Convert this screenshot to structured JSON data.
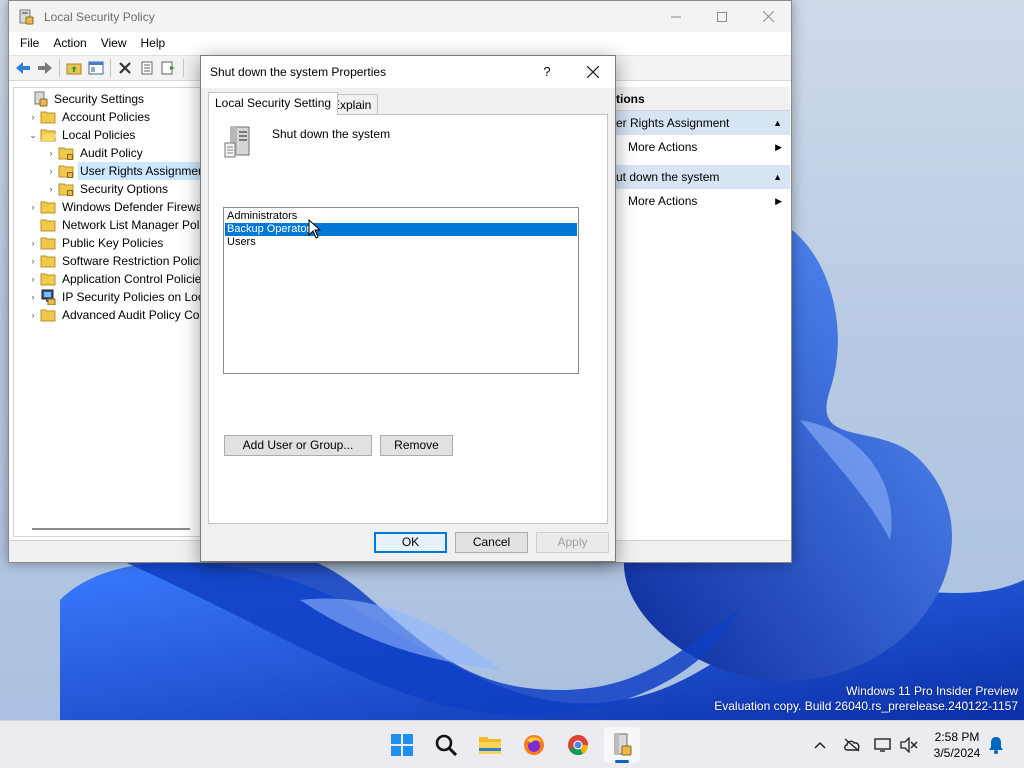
{
  "mmc": {
    "title": "Local Security Policy",
    "menu": [
      "File",
      "Action",
      "View",
      "Help"
    ],
    "tree": [
      {
        "label": "Security Settings",
        "icon": "security-settings-icon"
      },
      {
        "label": "Account Policies",
        "icon": "folder-icon"
      },
      {
        "label": "Local Policies",
        "icon": "folder-open-icon"
      },
      {
        "label": "Audit Policy",
        "icon": "folder-lock-icon"
      },
      {
        "label": "User Rights Assignment",
        "icon": "folder-lock-icon",
        "selected": true
      },
      {
        "label": "Security Options",
        "icon": "folder-lock-icon"
      },
      {
        "label": "Windows Defender Firewall",
        "icon": "folder-icon"
      },
      {
        "label": "Network List Manager Polic",
        "icon": "folder-icon"
      },
      {
        "label": "Public Key Policies",
        "icon": "folder-icon"
      },
      {
        "label": "Software Restriction Policie",
        "icon": "folder-icon"
      },
      {
        "label": "Application Control Policies",
        "icon": "folder-icon"
      },
      {
        "label": "IP Security Policies on Loca",
        "icon": "ip-security-icon"
      },
      {
        "label": "Advanced Audit Policy Con",
        "icon": "folder-icon"
      }
    ],
    "actions": {
      "header": "tions",
      "section1": "er Rights Assignment",
      "section1_item": "More Actions",
      "section2": "ut down the system",
      "section2_item": "More Actions"
    }
  },
  "dialog": {
    "title": "Shut down the system Properties",
    "help": "?",
    "close": "✕",
    "tabs": [
      "Local Security Setting",
      "Explain"
    ],
    "policy_name": "Shut down the system",
    "members": [
      "Administrators",
      "Backup Operators",
      "Users"
    ],
    "selected_member": "Backup Operators",
    "add_button": "Add User or Group...",
    "remove_button": "Remove",
    "ok": "OK",
    "cancel": "Cancel",
    "apply": "Apply"
  },
  "desktop": {
    "watermark_line1": "Windows 11 Pro Insider Preview",
    "watermark_line2": "Evaluation copy. Build 26040.rs_prerelease.240122-1157"
  },
  "taskbar": {
    "apps": [
      "start-icon",
      "search-icon",
      "file-explorer-icon",
      "firefox-icon",
      "chrome-icon",
      "local-security-policy-icon"
    ],
    "clock_time": "2:58 PM",
    "clock_date": "3/5/2024"
  },
  "colors": {
    "selection": "#0078d7",
    "tree_selection": "#cce8ff",
    "action_section": "#d6e4f3",
    "wallpaper_blue": "#1a4fd6"
  }
}
